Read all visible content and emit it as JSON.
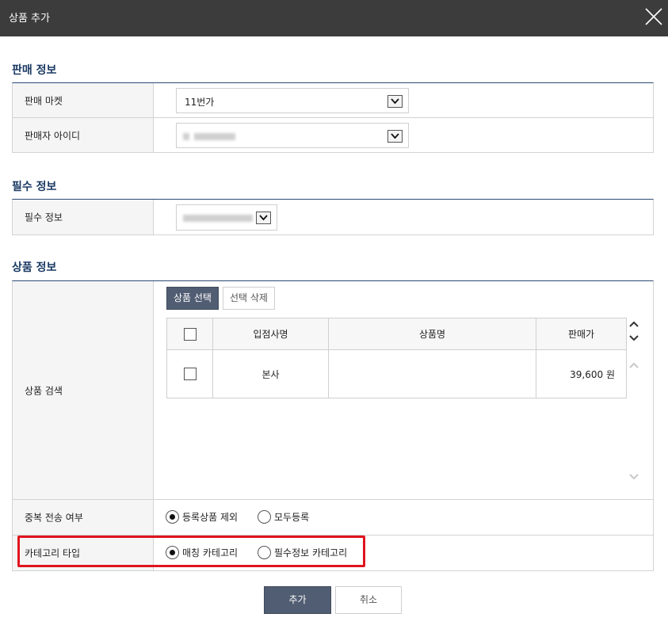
{
  "dialog": {
    "title": "상품 추가"
  },
  "sales_info": {
    "section_title": "판매 정보",
    "market_label": "판매 마켓",
    "market_value": "11번가",
    "seller_id_label": "판매자 아이디"
  },
  "required_info": {
    "section_title": "필수 정보",
    "label": "필수 정보"
  },
  "product_info": {
    "section_title": "상품 정보",
    "search_label": "상품 검색",
    "select_button": "상품 선택",
    "delete_button": "선택 삭제",
    "columns": [
      "입점사명",
      "상품명",
      "판매가"
    ],
    "rows": [
      {
        "vendor": "본사",
        "product_name": "",
        "price": "39,600 원"
      }
    ],
    "duplicate_label": "중복 전송 여부",
    "duplicate_options": [
      "등록상품 제외",
      "모두등록"
    ],
    "duplicate_selected": "등록상품 제외",
    "category_label": "카테고리 타입",
    "category_options": [
      "매칭 카테고리",
      "필수정보 카테고리"
    ],
    "category_selected": "매칭 카테고리"
  },
  "footer": {
    "add_button": "추가",
    "cancel_button": "취소"
  },
  "colors": {
    "titlebar": "#3c3c3c",
    "section_title": "#1b3a63",
    "primary_button": "#515d72",
    "highlight": "#e0141e"
  }
}
